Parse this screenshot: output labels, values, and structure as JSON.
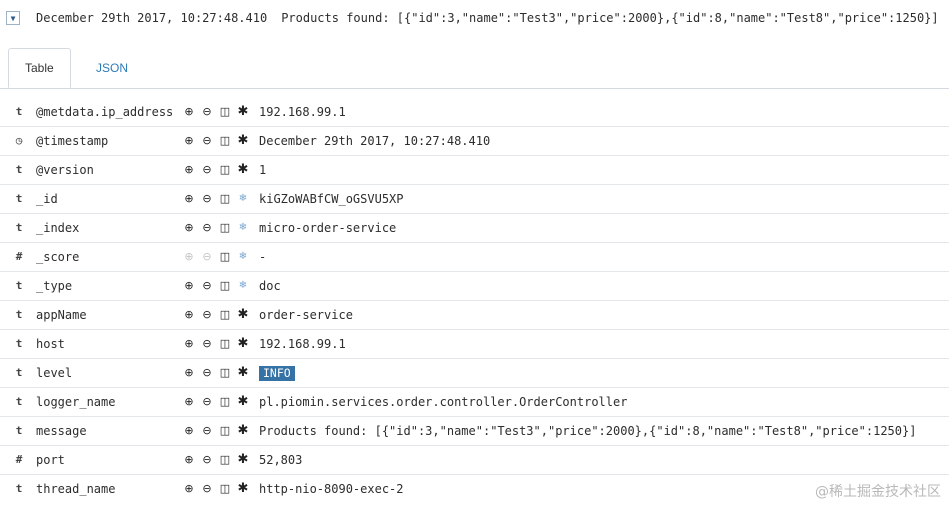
{
  "header": {
    "timestamp": "December 29th 2017, 10:27:48.410",
    "message": "Products found: [{\"id\":3,\"name\":\"Test3\",\"price\":2000},{\"id\":8,\"name\":\"Test8\",\"price\":1250}]"
  },
  "tabs": [
    {
      "label": "Table",
      "active": true
    },
    {
      "label": "JSON",
      "active": false
    }
  ],
  "fields": [
    {
      "type": "t",
      "name": "@metdata.ip_address",
      "value": "192.168.99.1"
    },
    {
      "type": "clock",
      "name": "@timestamp",
      "value": "December 29th 2017, 10:27:48.410"
    },
    {
      "type": "t",
      "name": "@version",
      "value": "1"
    },
    {
      "type": "t",
      "name": "_id",
      "value": "kiGZoWABfCW_oGSVU5XP"
    },
    {
      "type": "t",
      "name": "_index",
      "value": "micro-order-service"
    },
    {
      "type": "#",
      "name": "_score",
      "value": " -"
    },
    {
      "type": "t",
      "name": "_type",
      "value": "doc"
    },
    {
      "type": "t",
      "name": "appName",
      "value": "order-service"
    },
    {
      "type": "t",
      "name": "host",
      "value": "192.168.99.1"
    },
    {
      "type": "t",
      "name": "level",
      "value": "INFO"
    },
    {
      "type": "t",
      "name": "logger_name",
      "value": "pl.piomin.services.order.controller.OrderController"
    },
    {
      "type": "t",
      "name": "message",
      "value": "Products found: [{\"id\":3,\"name\":\"Test3\",\"price\":2000},{\"id\":8,\"name\":\"Test8\",\"price\":1250}]"
    },
    {
      "type": "#",
      "name": "port",
      "value": "52,803"
    },
    {
      "type": "t",
      "name": "thread_name",
      "value": "http-nio-8090-exec-2"
    }
  ],
  "watermark": "@稀土掘金技术社区"
}
